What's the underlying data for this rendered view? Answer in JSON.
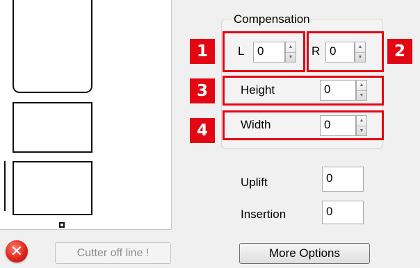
{
  "compensation": {
    "title": "Compensation",
    "left": {
      "label": "L",
      "value": "0",
      "badge": "1"
    },
    "right": {
      "label": "R",
      "value": "0",
      "badge": "2"
    },
    "height": {
      "label": "Height",
      "value": "0",
      "badge": "3"
    },
    "width": {
      "label": "Width",
      "value": "0",
      "badge": "4"
    }
  },
  "uplift": {
    "label": "Uplift",
    "value": "0"
  },
  "insertion": {
    "label": "Insertion",
    "value": "0"
  },
  "status": {
    "text": "Cutter off line !",
    "icon": "error-icon"
  },
  "more_options": {
    "label": "More Options"
  },
  "colors": {
    "highlight": "#e30613",
    "error": "#e0251a"
  }
}
